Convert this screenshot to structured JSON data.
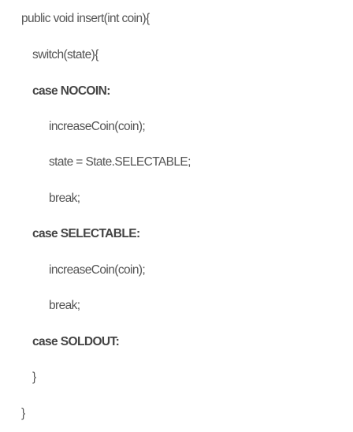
{
  "code": {
    "lines": [
      {
        "text": "public void insert(int coin){"
      },
      {
        "text": "switch(state){"
      },
      {
        "text": "case NOCOIN:"
      },
      {
        "text": "increaseCoin(coin);"
      },
      {
        "text": "state = State.SELECTABLE;"
      },
      {
        "text": "break;"
      },
      {
        "text": "case SELECTABLE:"
      },
      {
        "text": "increaseCoin(coin);"
      },
      {
        "text": "break;"
      },
      {
        "text": "case SOLDOUT:"
      },
      {
        "text": "}"
      },
      {
        "text": "}"
      }
    ]
  }
}
